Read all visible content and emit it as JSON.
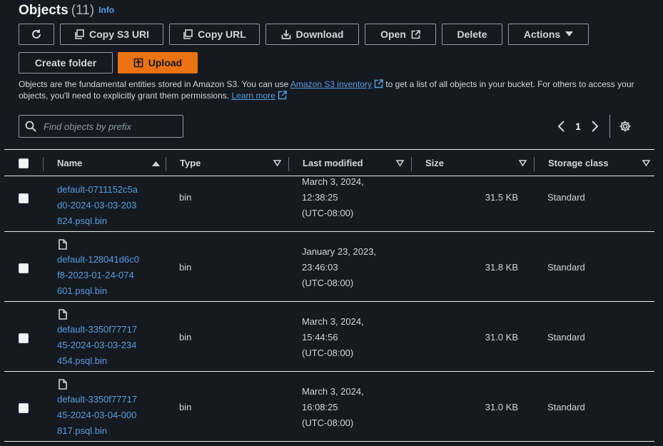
{
  "header": {
    "title": "Objects",
    "count": "(11)",
    "info": "Info"
  },
  "toolbar": {
    "copy_s3_uri": "Copy S3 URI",
    "copy_url": "Copy URL",
    "download": "Download",
    "open": "Open",
    "delete": "Delete",
    "actions": "Actions",
    "create_folder": "Create folder",
    "upload": "Upload"
  },
  "description": {
    "part1": "Objects are the fundamental entities stored in Amazon S3. You can use ",
    "link1": "Amazon S3 inventory",
    "part2": " to get a list of all objects in your bucket. For others to access your objects, you'll need to explicitly grant them permissions. ",
    "link2": "Learn more"
  },
  "search": {
    "placeholder": "Find objects by prefix",
    "value": ""
  },
  "pagination": {
    "current_page": "1"
  },
  "table": {
    "columns": {
      "name": "Name",
      "type": "Type",
      "last_modified": "Last modified",
      "size": "Size",
      "storage_class": "Storage class"
    },
    "rows": [
      {
        "name_lines": "default-0711152c5a\nd0-2024-03-03-203\n824.psql.bin",
        "type": "bin",
        "modified_lines": "March 3, 2024,\n12:38:25\n(UTC-08:00)",
        "size": "31.5 KB",
        "storage_class": "Standard"
      },
      {
        "name_lines": "default-128041d6c0\nf8-2023-01-24-074\n601.psql.bin",
        "type": "bin",
        "modified_lines": "January 23, 2023,\n23:46:03\n(UTC-08:00)",
        "size": "31.8 KB",
        "storage_class": "Standard"
      },
      {
        "name_lines": "default-3350f77717\n45-2024-03-03-234\n454.psql.bin",
        "type": "bin",
        "modified_lines": "March 3, 2024,\n15:44:56\n(UTC-08:00)",
        "size": "31.0 KB",
        "storage_class": "Standard"
      },
      {
        "name_lines": "default-3350f77717\n45-2024-03-04-000\n817.psql.bin",
        "type": "bin",
        "modified_lines": "March 3, 2024,\n16:08:25\n(UTC-08:00)",
        "size": "31.0 KB",
        "storage_class": "Standard"
      }
    ]
  },
  "colors": {
    "accent": "#ec7211",
    "link": "#539fe5",
    "background": "#16191f"
  }
}
